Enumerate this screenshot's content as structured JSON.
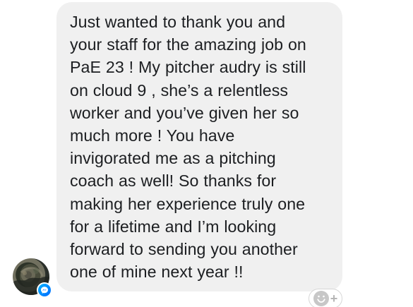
{
  "message": {
    "lines": [
      "Just wanted to thank you and",
      "your staff for the amazing job on",
      "PaE 23 ! My pitcher audry is still",
      "on cloud 9 , she’s a relentless",
      "worker and you’ve given her so",
      "much more ! You have",
      "invigorated me as a pitching",
      "coach as well! So thanks for",
      "making her experience truly one",
      "for a lifetime and I’m looking",
      "forward to sending you another",
      "one of mine next year !!"
    ]
  },
  "reaction": {
    "plus_label": "+"
  },
  "icons": {
    "avatar": "avatar",
    "badge": "messenger-icon",
    "reaction": "smiley-icon"
  },
  "colors": {
    "bubble": "#f0f0f0",
    "text": "#1c1e21",
    "messenger": "#006aff"
  }
}
